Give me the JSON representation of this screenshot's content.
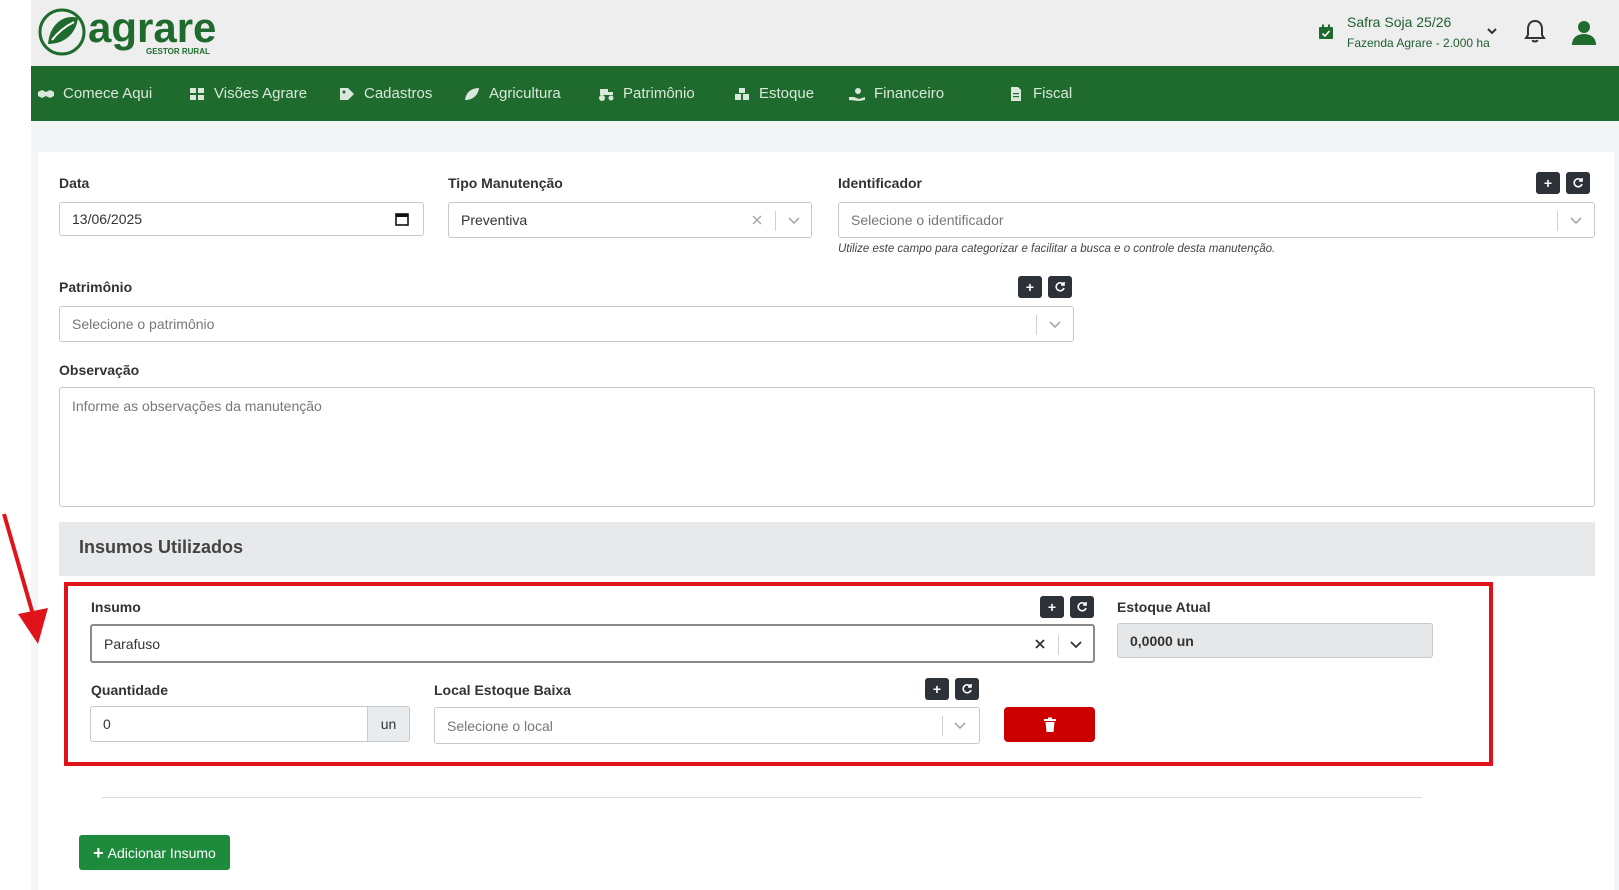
{
  "brand": {
    "name": "agrare",
    "tagline": "GESTOR RURAL",
    "color": "#1e6b2d"
  },
  "header": {
    "safra": "Safra Soja 25/26",
    "farm": "Fazenda Agrare - 2.000 ha"
  },
  "nav": {
    "items": [
      {
        "label": "Comece Aqui",
        "icon": "handshake-icon"
      },
      {
        "label": "Visões Agrare",
        "icon": "dashboard-icon"
      },
      {
        "label": "Cadastros",
        "icon": "tag-icon"
      },
      {
        "label": "Agricultura",
        "icon": "leaf-icon"
      },
      {
        "label": "Patrimônio",
        "icon": "tractor-icon"
      },
      {
        "label": "Estoque",
        "icon": "boxes-icon"
      },
      {
        "label": "Financeiro",
        "icon": "money-hand-icon"
      },
      {
        "label": "Fiscal",
        "icon": "invoice-icon"
      }
    ]
  },
  "form": {
    "data": {
      "label": "Data",
      "value": "13/06/2025"
    },
    "tipo": {
      "label": "Tipo Manutenção",
      "value": "Preventiva"
    },
    "identificador": {
      "label": "Identificador",
      "placeholder": "Selecione o identificador",
      "hint": "Utilize este campo para categorizar e facilitar a busca e o controle desta manutenção."
    },
    "patrimonio": {
      "label": "Patrimônio",
      "placeholder": "Selecione o patrimônio"
    },
    "observacao": {
      "label": "Observação",
      "placeholder": "Informe as observações da manutenção"
    }
  },
  "insumos": {
    "title": "Insumos Utilizados",
    "insumo": {
      "label": "Insumo",
      "value": "Parafuso"
    },
    "estoque": {
      "label": "Estoque Atual",
      "value": "0,0000 un"
    },
    "quantidade": {
      "label": "Quantidade",
      "value": "0",
      "unit": "un"
    },
    "local": {
      "label": "Local Estoque Baixa",
      "placeholder": "Selecione o local"
    },
    "add_button": "Adicionar Insumo"
  },
  "buttons": {
    "add": "+"
  },
  "colors": {
    "accent_green": "#1e8a3c",
    "danger": "#cc0000",
    "highlight": "#e0131b",
    "nav_bg": "#1e6b2d"
  }
}
